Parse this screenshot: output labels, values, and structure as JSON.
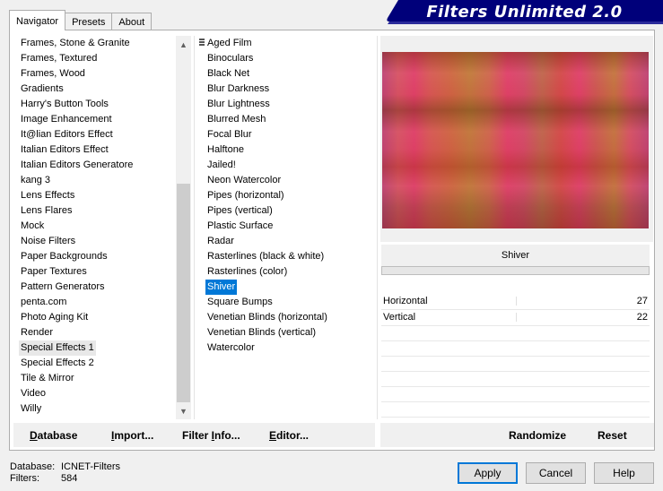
{
  "tabs": [
    {
      "label": "Navigator",
      "active": true
    },
    {
      "label": "Presets",
      "active": false
    },
    {
      "label": "About",
      "active": false
    }
  ],
  "banner": {
    "title": "Filters Unlimited 2.0",
    "color": "#00007a"
  },
  "categories": [
    "Frames, Stone & Granite",
    "Frames, Textured",
    "Frames, Wood",
    "Gradients",
    "Harry's Button Tools",
    "Image Enhancement",
    "It@lian Editors Effect",
    "Italian Editors Effect",
    "Italian Editors Generatore",
    "kang 3",
    "Lens Effects",
    "Lens Flares",
    "Mock",
    "Noise Filters",
    "Paper Backgrounds",
    "Paper Textures",
    "Pattern Generators",
    "penta.com",
    "Photo Aging Kit",
    "Render",
    "Special Effects 1",
    "Special Effects 2",
    "Tile & Mirror",
    "Video",
    "Willy"
  ],
  "selected_category": "Special Effects 1",
  "filters": [
    "Aged Film",
    "Binoculars",
    "Black Net",
    "Blur Darkness",
    "Blur Lightness",
    "Blurred Mesh",
    "Focal Blur",
    "Halftone",
    "Jailed!",
    "Neon Watercolor",
    "Pipes (horizontal)",
    "Pipes (vertical)",
    "Plastic Surface",
    "Radar",
    "Rasterlines (black & white)",
    "Rasterlines (color)",
    "Shiver",
    "Square Bumps",
    "Venetian Blinds (horizontal)",
    "Venetian Blinds (vertical)",
    "Watercolor"
  ],
  "selected_filter": "Shiver",
  "filter_name": "Shiver",
  "parameters": [
    {
      "label": "Horizontal",
      "value": "27"
    },
    {
      "label": "Vertical",
      "value": "22"
    }
  ],
  "toolbar": {
    "database": {
      "pre": "",
      "ul": "D",
      "post": "atabase"
    },
    "import": {
      "pre": "",
      "ul": "I",
      "post": "mport..."
    },
    "filter_info": {
      "pre": "Filter ",
      "ul": "I",
      "post": "nfo..."
    },
    "editor": {
      "pre": "",
      "ul": "E",
      "post": "ditor..."
    },
    "randomize": "Randomize",
    "reset": "Reset"
  },
  "status": {
    "database_label": "Database:",
    "database_value": "ICNET-Filters",
    "filters_label": "Filters:",
    "filters_value": "584"
  },
  "buttons": {
    "apply": "Apply",
    "cancel": "Cancel",
    "help": "Help"
  },
  "colors": {
    "selection": "#0078d7",
    "banner": "#00007a"
  }
}
